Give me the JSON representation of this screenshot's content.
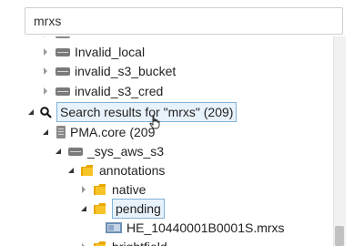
{
  "search": {
    "value": "mrxs"
  },
  "tree": {
    "invalid_local": "Invalid_local",
    "invalid_s3_bucket": "invalid_s3_bucket",
    "invalid_s3_cred": "invalid_s3_cred",
    "search_results": "Search results for \"mrxs\" (209)",
    "pma_core": "PMA.core (209",
    "sys_aws_s3": "_sys_aws_s3",
    "annotations": "annotations",
    "native": "native",
    "pending": "pending",
    "file": "HE_10440001B0001S.mrxs",
    "brightfield": "brightfield"
  },
  "colors": {
    "folder": "#f0b400",
    "drive": "#7a7a7a",
    "highlight": "#e8f2fb",
    "highlight_border": "#7fb2d9"
  }
}
